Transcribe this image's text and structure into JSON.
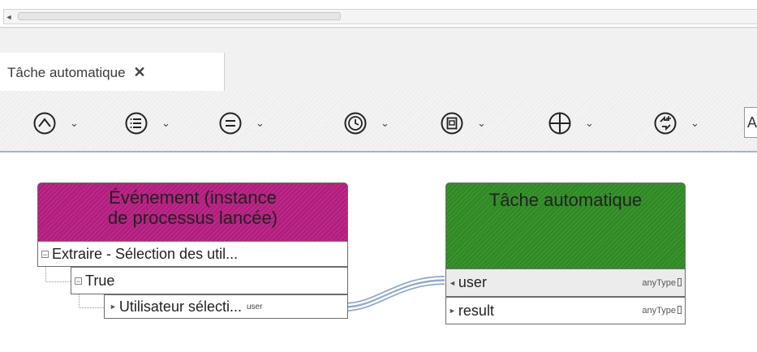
{
  "scrollbar": {
    "left_arrow": "◄"
  },
  "tab": {
    "title": "Tâche automatique",
    "close": "✕"
  },
  "toolbar": {
    "chevron": "⌄",
    "tools": [
      {
        "icon": "up-arrow-circle-icon"
      },
      {
        "icon": "list-circle-icon"
      },
      {
        "icon": "equals-circle-icon"
      },
      {
        "icon": "clock-circle-icon"
      },
      {
        "icon": "document-icon"
      },
      {
        "icon": "plus-circle-icon"
      },
      {
        "icon": "add-process-icon"
      }
    ],
    "overflow_text": "A"
  },
  "event_node": {
    "title_line1": "Événement (instance",
    "title_line2": "de processus lancée)",
    "header_color": "#b31d7e",
    "rows": [
      {
        "label": "Extraire - Sélection des util...",
        "expander": "−"
      },
      {
        "label": "True",
        "expander": "−"
      },
      {
        "label": "Utilisateur sélecti...",
        "tag": "user"
      }
    ]
  },
  "task_node": {
    "title": "Tâche automatique",
    "header_color": "#2f8a24",
    "rows": [
      {
        "label": "user",
        "type": "anyType"
      },
      {
        "label": "result",
        "type": "anyType"
      }
    ]
  }
}
